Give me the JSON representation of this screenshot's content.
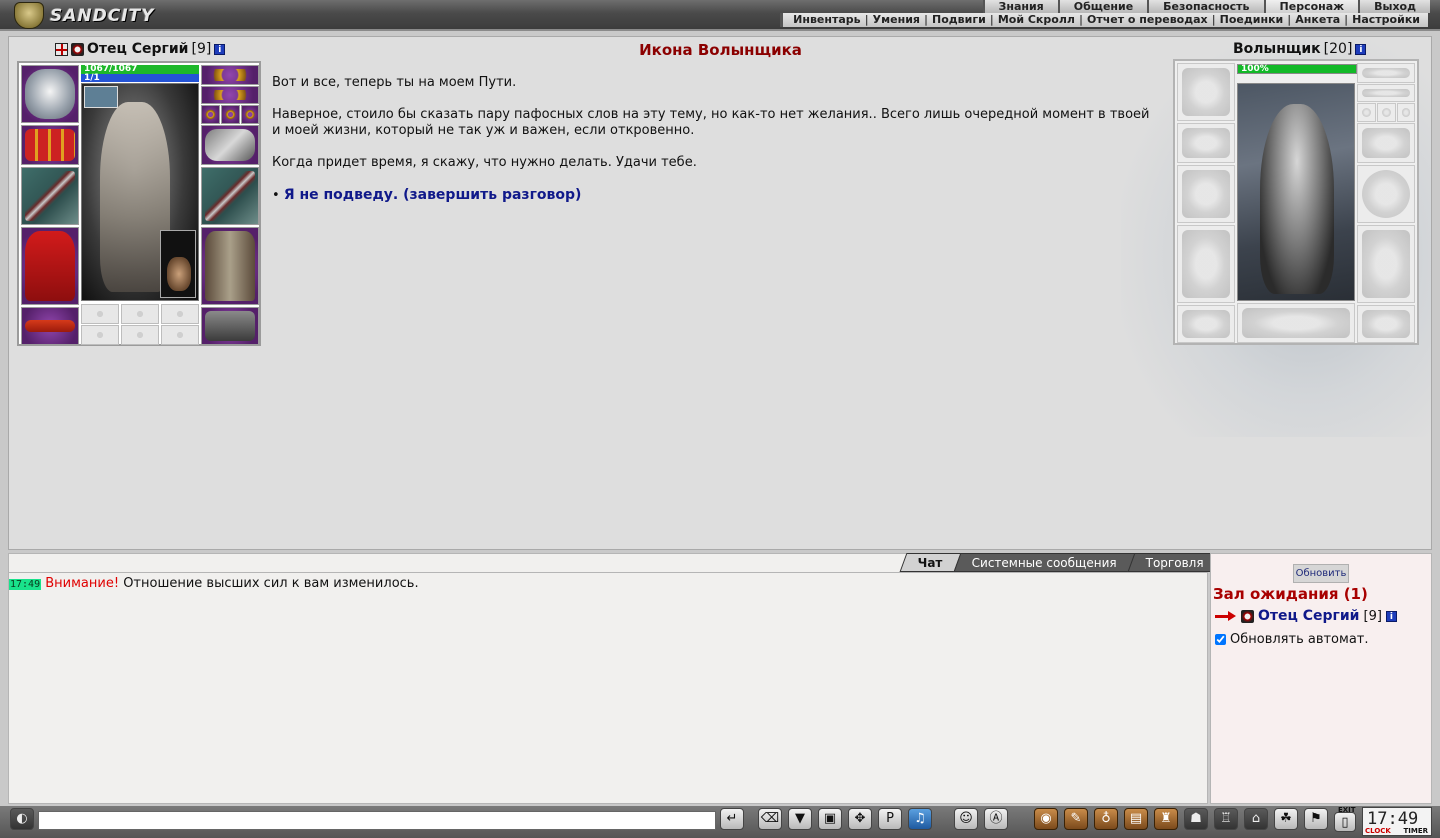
{
  "app": {
    "logo_text": "SANDCITY"
  },
  "main_menu": [
    "Знания",
    "Общение",
    "Безопасность",
    "Персонаж",
    "Выход"
  ],
  "sub_menu": [
    "Инвентарь",
    "Умения",
    "Подвиги",
    "Мой Скролл",
    "Отчет о переводах",
    "Поединки",
    "Анкета",
    "Настройки"
  ],
  "player": {
    "name": "Отец Сергий",
    "level": "[9]",
    "hp": "1067/1067",
    "mp": "1/1"
  },
  "enemy": {
    "name": "Волынщик",
    "level": "[20]",
    "hp": "100%"
  },
  "dialog": {
    "title": "Икона Волынщика",
    "paragraphs": [
      "Вот и все, теперь ты на моем Пути.",
      "Наверное, стоило бы сказать пару пафосных слов на эту тему, но как-то нет желания.. Всего лишь очередной момент в твоей и моей жизни, который не так уж и важен, если откровенно.",
      "Когда придет время, я скажу, что нужно делать. Удачи тебе."
    ],
    "answer": "Я не подведу. (завершить разговор)"
  },
  "chat": {
    "tabs": [
      "Чат",
      "Системные сообщения",
      "Торговля"
    ],
    "messages": [
      {
        "time": "17:49",
        "prefix": "Внимание!",
        "text": "Отношение высших сил к вам изменилось."
      }
    ],
    "input_value": ""
  },
  "side": {
    "refresh_label": "Обновить",
    "room_title": "Зал ожидания (1)",
    "user_name": "Отец Сергий",
    "user_level": "[9]",
    "auto_refresh_label": "Обновлять автомат."
  },
  "clock": {
    "time": "17:49",
    "label_clock": "CLOCK",
    "label_timer": "TIMER",
    "exit_label": "EXIT"
  },
  "colors": {
    "accent_red": "#8b0000",
    "link_blue": "#10198a",
    "hp_green": "#1db82a",
    "mp_blue": "#2454d6"
  }
}
